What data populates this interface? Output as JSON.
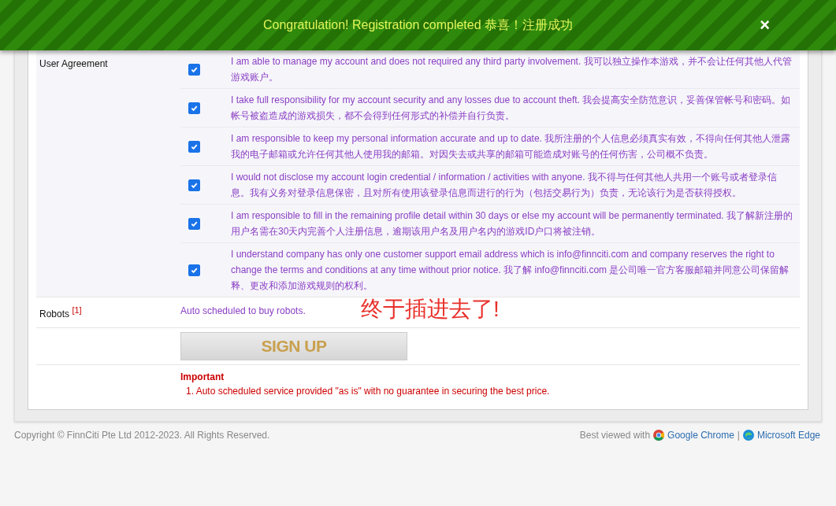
{
  "banner": {
    "message": "Congratulation! Registration completed 恭喜！注册成功",
    "close": "×"
  },
  "agreement": {
    "label": "User Agreement",
    "items": [
      {
        "checked": true,
        "text": "I am able to manage my account and does not required any third party involvement. 我可以独立操作本游戏，并不会让任何其他人代管游戏账户。"
      },
      {
        "checked": true,
        "text": "I take full responsibility for my account security and any losses due to account theft. 我会提高安全防范意识，妥善保管帐号和密码。如帐号被盗造成的游戏损失，都不会得到任何形式的补偿并自行负责。"
      },
      {
        "checked": true,
        "text": "I am responsible to keep my personal information accurate and up to date. 我所注册的个人信息必须真实有效，不得向任何其他人泄露我的电子邮箱或允许任何其他人使用我的邮箱。对因失去或共享的邮箱可能造成对账号的任何伤害，公司概不负责。"
      },
      {
        "checked": true,
        "text": "I would not disclose my account login credential / information / activities with anyone. 我不得与任何其他人共用一个账号或者登录信息。我有义务对登录信息保密，且对所有使用该登录信息而进行的行为（包括交易行为）负责，无论该行为是否获得授权。"
      },
      {
        "checked": true,
        "text": "I am responsible to fill in the remaining profile detail within 30 days or else my account will be permanently terminated. 我了解新注册的用户名需在30天内完善个人注册信息，逾期该用户名及用户名内的游戏ID户口将被注销。"
      },
      {
        "checked": true,
        "text": "I understand company has only one customer support email address which is info@finnciti.com and company reserves the right to change the terms and conditions at any time without prior notice. 我了解 info@finnciti.com 是公司唯一官方客服邮箱并同意公司保留解释、更改和添加游戏规则的权利。"
      }
    ]
  },
  "robots": {
    "label": "Robots",
    "footnote": "[1]",
    "value": "Auto scheduled to buy robots.",
    "annotation": "终于插进去了!"
  },
  "signup_button": "SIGN UP",
  "important": {
    "title": "Important",
    "notes": [
      "1. Auto scheduled service provided \"as is\" with no guarantee in securing the best price."
    ]
  },
  "footer": {
    "copyright": "Copyright © FinnCiti Pte Ltd 2012-2023. All Rights Reserved.",
    "best_viewed": "Best viewed with",
    "browsers": [
      "Google Chrome",
      "Microsoft Edge"
    ],
    "separator": "|"
  }
}
